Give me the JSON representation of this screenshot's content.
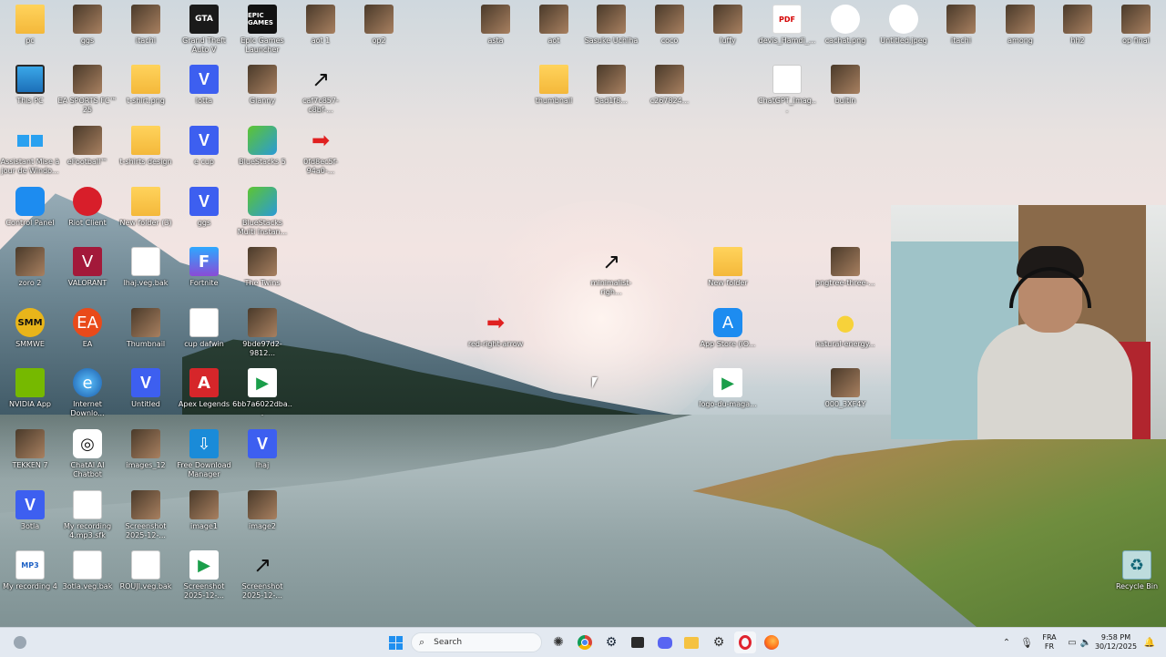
{
  "desktop_icons": [
    {
      "label": "pc",
      "icon": "folder-icon"
    },
    {
      "label": "ggs",
      "icon": "photo-icon"
    },
    {
      "label": "itachi",
      "icon": "photo-icon"
    },
    {
      "label": "Grand Theft Auto V",
      "icon": "gta-icon",
      "glyph": "GTA"
    },
    {
      "label": "Epic Games Launcher",
      "icon": "epic-icon",
      "glyph": "EPIC GAMES"
    },
    {
      "label": "aot 1",
      "icon": "photo-icon"
    },
    {
      "label": "op2",
      "icon": "photo-icon"
    },
    {
      "label": "asta",
      "icon": "photo-icon"
    },
    {
      "label": "aot",
      "icon": "photo-icon"
    },
    {
      "label": "Sasuke Uchiha",
      "icon": "photo-icon"
    },
    {
      "label": "coco",
      "icon": "photo-icon"
    },
    {
      "label": "luffy",
      "icon": "photo-icon"
    },
    {
      "label": "devis_Hamdi_...",
      "icon": "pdf-icon",
      "glyph": "PDF"
    },
    {
      "label": "cachat.png",
      "icon": "png-icon"
    },
    {
      "label": "Untitled.jpeg",
      "icon": "png-icon"
    },
    {
      "label": "itachi",
      "icon": "photo-icon"
    },
    {
      "label": "among",
      "icon": "photo-icon"
    },
    {
      "label": "hh2",
      "icon": "photo-icon"
    },
    {
      "label": "op final",
      "icon": "photo-icon"
    },
    {
      "label": "This PC",
      "icon": "monitor-icon"
    },
    {
      "label": "EA SPORTS FC™ 25",
      "icon": "photo-icon"
    },
    {
      "label": "t-shirt.png",
      "icon": "folder-icon"
    },
    {
      "label": "lotta",
      "icon": "v-icon",
      "glyph": "V"
    },
    {
      "label": "Gianny",
      "icon": "photo-icon"
    },
    {
      "label": "caf7c857-c8bf-...",
      "icon": "arrow-black-icon",
      "glyph": "↗"
    },
    {
      "label": "thumbnail",
      "icon": "folder-icon"
    },
    {
      "label": "5ad1f8...",
      "icon": "photo-icon"
    },
    {
      "label": "c267824...",
      "icon": "photo-icon"
    },
    {
      "label": "ChatGPT_Imag...",
      "icon": "doc-icon"
    },
    {
      "label": "bultin",
      "icon": "photo-icon"
    },
    {
      "label": "Assistant Mise à jour de Windo...",
      "icon": "windows-icon"
    },
    {
      "label": "eFootball™",
      "icon": "photo-icon"
    },
    {
      "label": "t-shirts design",
      "icon": "folder-icon"
    },
    {
      "label": "e cup",
      "icon": "v-icon",
      "glyph": "V"
    },
    {
      "label": "BlueStacks 5",
      "icon": "bluestacks-icon"
    },
    {
      "label": "0fd8ec5f-94a0-...",
      "icon": "arrow-red-icon",
      "glyph": "➡"
    },
    {
      "label": "Control Panel",
      "icon": "control-panel-icon"
    },
    {
      "label": "Riot Client",
      "icon": "riot-icon"
    },
    {
      "label": "New folder (3)",
      "icon": "folder-icon"
    },
    {
      "label": "ggs",
      "icon": "v-icon",
      "glyph": "V"
    },
    {
      "label": "BlueStacks Multi Instan...",
      "icon": "bluestacks-icon"
    },
    {
      "label": "zoro 2",
      "icon": "photo-icon"
    },
    {
      "label": "VALORANT",
      "icon": "valorant-icon",
      "glyph": "V"
    },
    {
      "label": "lhaj.veg.bak",
      "icon": "doc-icon"
    },
    {
      "label": "Fortnite",
      "icon": "fortnite-icon",
      "glyph": "F"
    },
    {
      "label": "The Twins",
      "icon": "photo-icon"
    },
    {
      "label": "minimalist-righ...",
      "icon": "arrow-black-icon",
      "glyph": "↗"
    },
    {
      "label": "New folder",
      "icon": "folder-icon"
    },
    {
      "label": "pngtree-three-...",
      "icon": "photo-icon"
    },
    {
      "label": "SMMWE",
      "icon": "smm-icon",
      "glyph": "SMM"
    },
    {
      "label": "EA",
      "icon": "ea-icon",
      "glyph": "EA"
    },
    {
      "label": "Thumbnail",
      "icon": "photo-icon"
    },
    {
      "label": "cup dafwin",
      "icon": "doc-icon"
    },
    {
      "label": "9bde97d2-9812...",
      "icon": "photo-icon"
    },
    {
      "label": "red-right-arrow",
      "icon": "arrow-red-icon",
      "glyph": "➡"
    },
    {
      "label": "App Store (iO...",
      "icon": "app-store-icon",
      "glyph": "A"
    },
    {
      "label": "natural-energy...",
      "icon": "sun-icon",
      "glyph": "●"
    },
    {
      "label": "NVIDIA App",
      "icon": "nvidia-icon"
    },
    {
      "label": "Internet Downlo...",
      "icon": "internet-download-icon",
      "glyph": "e"
    },
    {
      "label": "Untitled",
      "icon": "v-icon",
      "glyph": "V"
    },
    {
      "label": "Apex Legends",
      "icon": "apex-icon",
      "glyph": "A"
    },
    {
      "label": "6bb7a6022dba...",
      "icon": "play-store-icon",
      "glyph": "▶"
    },
    {
      "label": "logo-du-maga...",
      "icon": "play-store-icon",
      "glyph": "▶"
    },
    {
      "label": "000_3XF4Y",
      "icon": "photo-icon"
    },
    {
      "label": "TEKKEN 7",
      "icon": "photo-icon"
    },
    {
      "label": "ChatAI AI Chatbot",
      "icon": "chatbot-icon",
      "glyph": "◎"
    },
    {
      "label": "images_12",
      "icon": "photo-icon"
    },
    {
      "label": "Free Download Manager",
      "icon": "fdm-icon",
      "glyph": "⇩"
    },
    {
      "label": "lhaj",
      "icon": "v-icon",
      "glyph": "V"
    },
    {
      "label": "3otla",
      "icon": "v-icon",
      "glyph": "V"
    },
    {
      "label": "My recording 4.mp3.sfk",
      "icon": "doc-icon"
    },
    {
      "label": "Screenshot 2025-12-...",
      "icon": "photo-icon"
    },
    {
      "label": "image1",
      "icon": "photo-icon"
    },
    {
      "label": "image2",
      "icon": "photo-icon"
    },
    {
      "label": "My recording 4",
      "icon": "mp3-icon",
      "glyph": "MP3"
    },
    {
      "label": "3otla.veg.bak",
      "icon": "doc-icon"
    },
    {
      "label": "ROUJI.veg.bak",
      "icon": "doc-icon"
    },
    {
      "label": "Screenshot 2025-12-...",
      "icon": "play-store-icon",
      "glyph": "▶"
    },
    {
      "label": "Screenshot 2025-12-...",
      "icon": "arrow-black-icon",
      "glyph": "↗"
    },
    {
      "label": "Recycle Bin",
      "icon": "recycle-bin-icon",
      "glyph": "♻"
    }
  ],
  "taskbar": {
    "search_placeholder": "Search",
    "language": "FRA",
    "layout": "FR",
    "time": "9:58 PM",
    "date": "30/12/2025",
    "apps": [
      "start-icon",
      "chatgpt-icon",
      "chrome-icon",
      "steam-icon",
      "capture-icon",
      "discord-icon",
      "file-explorer-icon",
      "settings-icon",
      "opera-gx-icon",
      "firefox-icon"
    ]
  }
}
